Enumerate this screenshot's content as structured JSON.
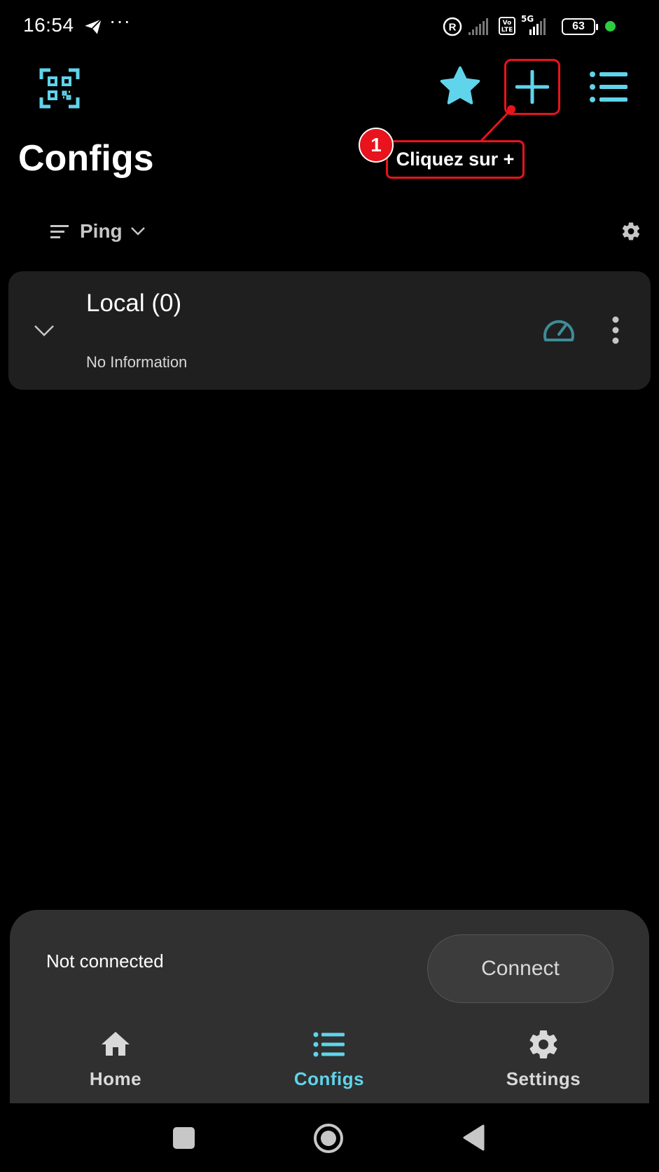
{
  "status_bar": {
    "time": "16:54",
    "more": "···",
    "volte": "Vo\nLTE",
    "network": "5G",
    "battery": "63",
    "icons": [
      "telegram-send-icon",
      "registered-icon",
      "signal-icon",
      "volte-icon",
      "5g-signal-icon",
      "battery-icon",
      "green-dot-icon"
    ]
  },
  "app_bar": {
    "icons": [
      "qr-code-icon",
      "star-icon",
      "plus-icon",
      "list-menu-icon"
    ]
  },
  "annotation": {
    "number": "1",
    "text": "Cliquez sur +"
  },
  "page": {
    "title": "Configs"
  },
  "sort": {
    "label": "Ping"
  },
  "group": {
    "title": "Local (0)",
    "subtitle": "No Information"
  },
  "connection": {
    "status": "Not connected",
    "button_label": "Connect"
  },
  "bottom_nav": {
    "items": [
      {
        "label": "Home",
        "icon": "home-icon"
      },
      {
        "label": "Configs",
        "icon": "list-icon",
        "active": true
      },
      {
        "label": "Settings",
        "icon": "gear-icon"
      }
    ]
  },
  "colors": {
    "accent": "#5fd4eb",
    "annotation_red": "#e8131c",
    "card_bg": "#1f1f1f",
    "sheet_bg": "#303030"
  }
}
